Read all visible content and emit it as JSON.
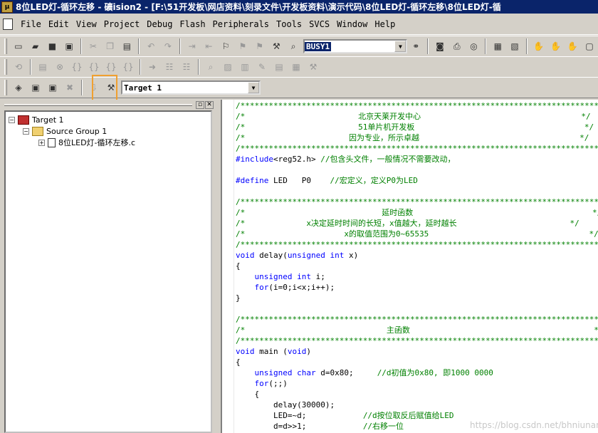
{
  "window": {
    "title": "8位LED灯-循环左移   - 礦ision2 - [F:\\51开发板\\网店资料\\刻录文件\\开发板资料\\演示代码\\8位LED灯-循环左移\\8位LED灯-循"
  },
  "menu": [
    "File",
    "Edit",
    "View",
    "Project",
    "Debug",
    "Flash",
    "Peripherals",
    "Tools",
    "SVCS",
    "Window",
    "Help"
  ],
  "toolbar1": {
    "find_combo_value": "BUSY1"
  },
  "toolbar3": {
    "target_combo_value": "Target 1"
  },
  "tree": {
    "target": "Target 1",
    "group": "Source Group 1",
    "file": "8位LED灯-循环左移.c"
  },
  "code": {
    "l1": "/*****************************************************************************/",
    "l2": "/*                        北京天莱开发中心                                  */",
    "l3": "/*                        51单片机开发板                                    */",
    "l4": "/*                      因为专业，所示卓越                                  */",
    "l5": "/*****************************************************************************/",
    "l6_kw": "#include",
    "l6_rest": "<reg52.h> ",
    "l6_cm": "//包含头文件，一般情况不需要改动，",
    "l7_kw": "#define",
    "l7_rest": " LED   P0    ",
    "l7_cm": "//宏定义，定义P0为LED",
    "l8": "/*****************************************************************************/",
    "l9": "/*                             延时函数                                      */",
    "l10": "/*             x决定延时时间的长短，x值越大，延时越长                        */",
    "l11": "/*                     x的取值范围为0~65535                                  */",
    "l12": "/*****************************************************************************/",
    "l13_kw1": "void",
    "l13_a": " delay(",
    "l13_kw2": "unsigned int",
    "l13_b": " x)",
    "l14": "{",
    "l15_kw": "    unsigned int",
    "l15_rest": " i;",
    "l16_kw": "    for",
    "l16_rest": "(i=0;i<x;i++);",
    "l17": "}",
    "l18": "/*****************************************************************************/",
    "l19": "/*                              主函数                                       */",
    "l20": "/*****************************************************************************/",
    "l21_kw1": "void",
    "l21_a": " main (",
    "l21_kw2": "void",
    "l21_b": ")",
    "l22": "{",
    "l23_kw": "    unsigned char",
    "l23_rest": " d=0x80;     ",
    "l23_cm": "//d初值为0x80, 即1000 0000",
    "l24_kw": "    for",
    "l24_rest": "(;;)",
    "l25": "    {",
    "l26": "        delay(30000);",
    "l27_rest": "        LED=~d;            ",
    "l27_cm": "//d按位取反后赋值给LED",
    "l28_rest": "        d=d>>1;            ",
    "l28_cm": "//右移一位"
  },
  "watermark": "https://blog.csdn.net/bhniunan"
}
